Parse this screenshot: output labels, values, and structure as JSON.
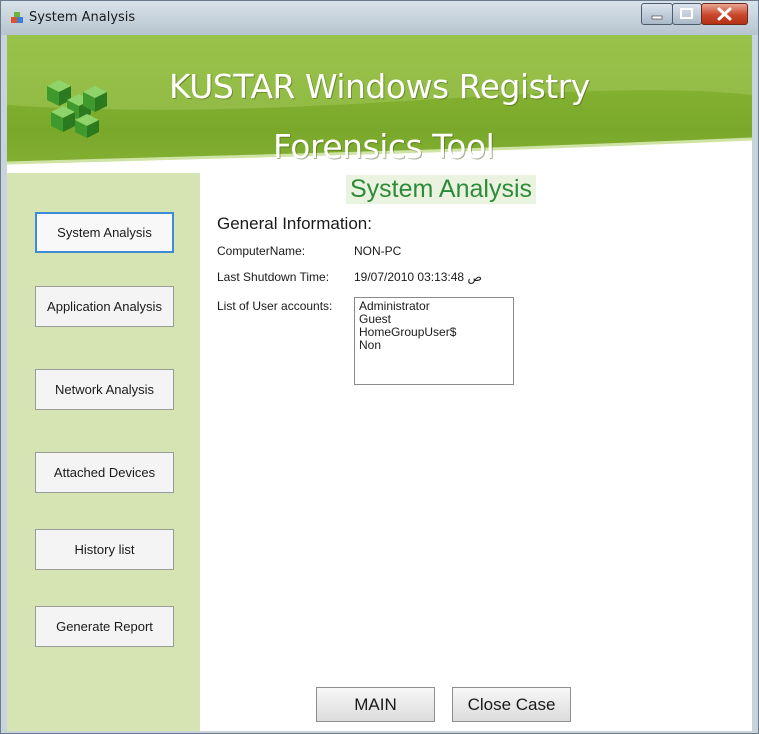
{
  "window": {
    "title": "System Analysis",
    "icons": [
      "app-icon",
      "minimize-icon",
      "maximize-icon",
      "close-icon"
    ]
  },
  "banner": {
    "title_line_1": "KUSTAR Windows Registry",
    "title_line_2": "Forensics Tool",
    "logo": "registry-cubes-logo"
  },
  "sidebar": {
    "items": [
      {
        "label": "System Analysis",
        "active": true
      },
      {
        "label": "Application Analysis",
        "active": false
      },
      {
        "label": "Network Analysis",
        "active": false
      },
      {
        "label": "Attached Devices",
        "active": false
      },
      {
        "label": "History list",
        "active": false
      },
      {
        "label": "Generate Report",
        "active": false
      }
    ]
  },
  "content": {
    "section_title": "System Analysis",
    "heading": "General Information:",
    "computer_name_label": "ComputerName:",
    "computer_name_value": "NON-PC",
    "shutdown_label": "Last Shutdown Time:",
    "shutdown_value": "19/07/2010 03:13:48 ص",
    "accounts_label": "List of User accounts:",
    "accounts": [
      "Administrator",
      "Guest",
      "HomeGroupUser$",
      "Non"
    ]
  },
  "footer": {
    "main_label": "MAIN",
    "close_case_label": "Close Case"
  },
  "colors": {
    "banner_green": "#7aa82a",
    "sidebar_green": "#d5e4b2",
    "section_title_green": "#2e8b3a",
    "active_button_border": "#3d8bd6"
  }
}
